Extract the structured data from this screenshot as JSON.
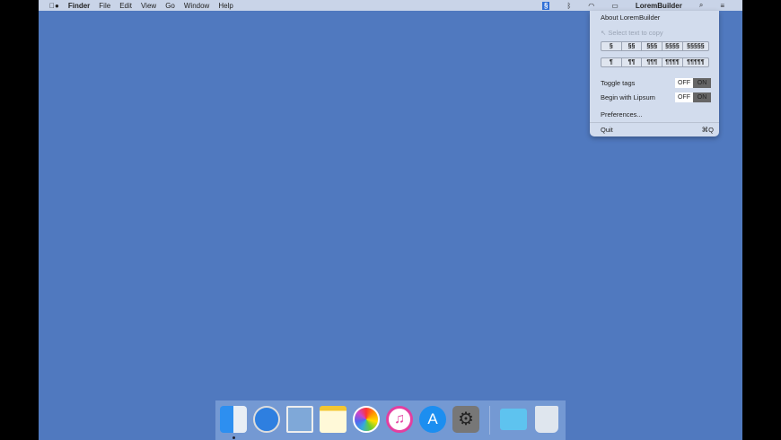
{
  "menubar": {
    "app": "Finder",
    "items": [
      "File",
      "Edit",
      "View",
      "Go",
      "Window",
      "Help"
    ],
    "status_app": "LoremBuilder",
    "status_icon": "§"
  },
  "menu": {
    "about": "About LoremBuilder",
    "select_hint": "↖ Select text to copy",
    "section_buttons": [
      "§",
      "§§",
      "§§§",
      "§§§§",
      "§§§§§"
    ],
    "paragraph_buttons": [
      "¶",
      "¶¶",
      "¶¶¶",
      "¶¶¶¶",
      "¶¶¶¶¶"
    ],
    "toggle_tags": {
      "label": "Toggle tags",
      "off": "OFF",
      "on": "ON",
      "value": "ON"
    },
    "begin_lipsum": {
      "label": "Begin with Lipsum",
      "off": "OFF",
      "on": "ON",
      "value": "ON"
    },
    "preferences": "Preferences...",
    "quit": "Quit",
    "quit_shortcut": "⌘Q"
  },
  "dock": [
    "finder",
    "safari",
    "preview",
    "notes",
    "photos",
    "itunes",
    "app-store",
    "system-preferences",
    "applications-folder",
    "trash"
  ]
}
